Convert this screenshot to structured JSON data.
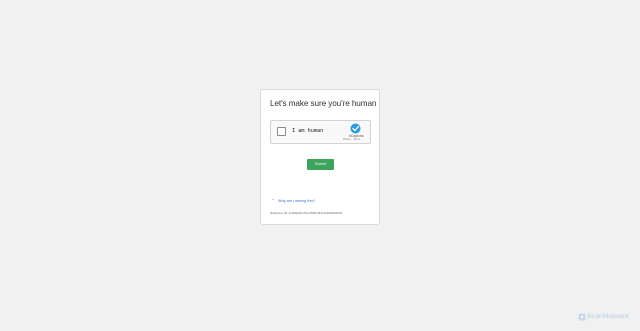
{
  "card": {
    "title": "Let's make sure you're human"
  },
  "captcha": {
    "label": "I am human",
    "brand": "hCaptcha",
    "privacy_link": "Privacy",
    "terms_link": "Terms"
  },
  "form": {
    "submit_label": "Submit"
  },
  "footer": {
    "why_text": "Why am I seeing this?",
    "reference": "Reference ID: 4e3d6dd8-c7ba-4530-9fca-6140bf909478"
  },
  "brandmark": {
    "text": "ScanMalware"
  },
  "colors": {
    "background": "#f1f1f1",
    "submit": "#3da35d",
    "link": "#3a6fc4",
    "captcha_logo": "#2c9bd8"
  }
}
